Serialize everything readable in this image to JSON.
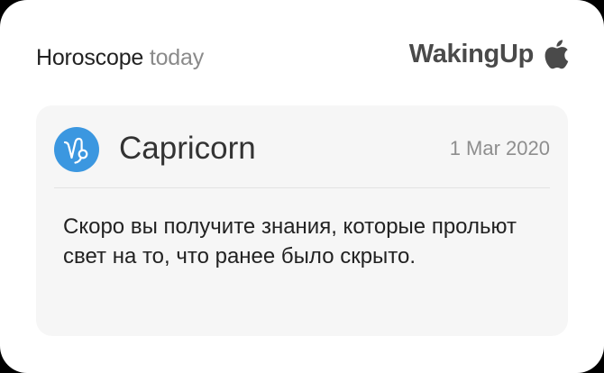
{
  "header": {
    "title": "Horoscope",
    "subtitle": "today"
  },
  "brand": {
    "name": "WakingUp",
    "icon": "apple-icon"
  },
  "card": {
    "sign_icon": "capricorn-icon",
    "sign_name": "Capricorn",
    "date": "1 Mar 2020",
    "prediction": "Скоро вы получите знания, которые прольют свет на то, что ранее было скрыто."
  },
  "colors": {
    "badge": "#3b97e0",
    "card_background": "#f6f6f6",
    "widget_background": "#ffffff"
  }
}
